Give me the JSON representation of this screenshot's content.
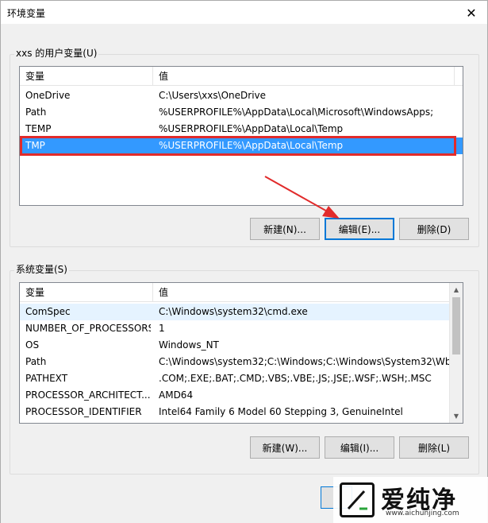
{
  "window": {
    "title": "环境变量"
  },
  "user_vars": {
    "group_label": "xxs 的用户变量(U)",
    "columns": [
      "变量",
      "值"
    ],
    "rows": [
      {
        "name": "OneDrive",
        "value": "C:\\Users\\xxs\\OneDrive"
      },
      {
        "name": "Path",
        "value": "%USERPROFILE%\\AppData\\Local\\Microsoft\\WindowsApps;"
      },
      {
        "name": "TEMP",
        "value": "%USERPROFILE%\\AppData\\Local\\Temp"
      },
      {
        "name": "TMP",
        "value": "%USERPROFILE%\\AppData\\Local\\Temp",
        "selected": true
      }
    ],
    "buttons": {
      "new": "新建(N)...",
      "edit": "编辑(E)...",
      "delete": "删除(D)"
    }
  },
  "system_vars": {
    "group_label": "系统变量(S)",
    "columns": [
      "变量",
      "值"
    ],
    "rows": [
      {
        "name": "ComSpec",
        "value": "C:\\Windows\\system32\\cmd.exe"
      },
      {
        "name": "NUMBER_OF_PROCESSORS",
        "value": "1"
      },
      {
        "name": "OS",
        "value": "Windows_NT"
      },
      {
        "name": "Path",
        "value": "C:\\Windows\\system32;C:\\Windows;C:\\Windows\\System32\\Wb..."
      },
      {
        "name": "PATHEXT",
        "value": ".COM;.EXE;.BAT;.CMD;.VBS;.VBE;.JS;.JSE;.WSF;.WSH;.MSC"
      },
      {
        "name": "PROCESSOR_ARCHITECT...",
        "value": "AMD64"
      },
      {
        "name": "PROCESSOR_IDENTIFIER",
        "value": "Intel64 Family 6 Model 60 Stepping 3, GenuineIntel"
      }
    ],
    "buttons": {
      "new": "新建(W)...",
      "edit": "编辑(I)...",
      "delete": "删除(L)"
    }
  },
  "watermark": {
    "brand": "爱纯净",
    "url": "www.aichunjing.com"
  },
  "colors": {
    "selection": "#3399ff",
    "highlight": "#e12b2b",
    "accent": "#0078d7"
  }
}
